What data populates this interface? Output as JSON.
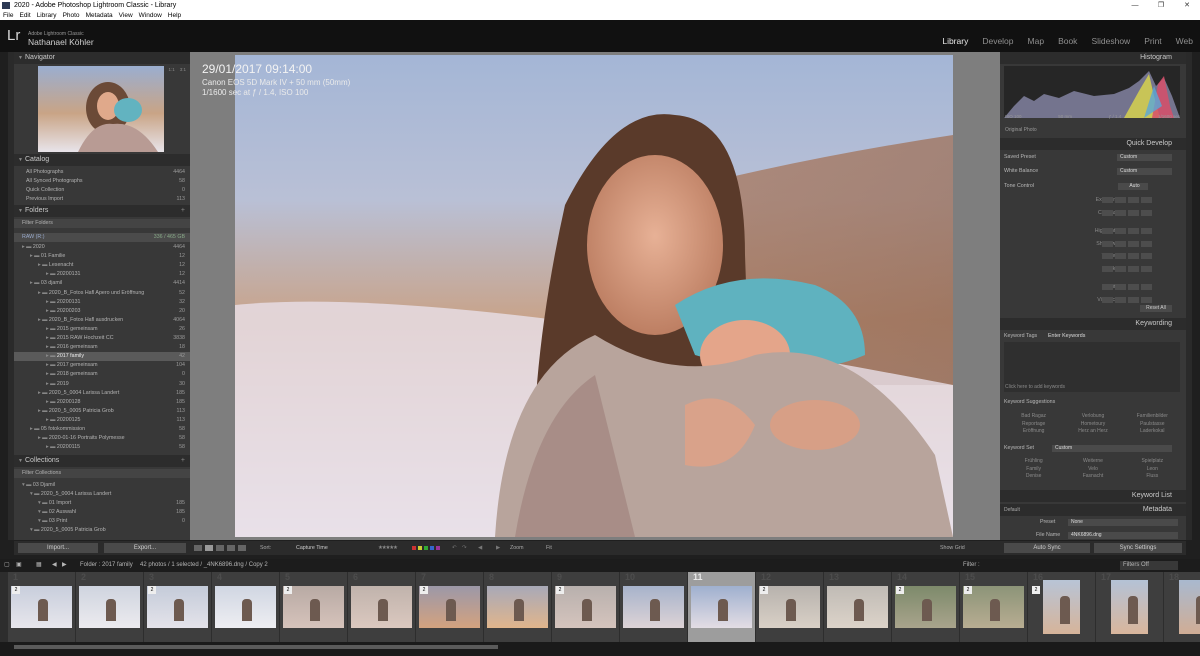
{
  "window": {
    "title": "2020 - Adobe Photoshop Lightroom Classic - Library",
    "menu": [
      "File",
      "Edit",
      "Library",
      "Photo",
      "Metadata",
      "View",
      "Window",
      "Help"
    ]
  },
  "identity": {
    "logo": "Lr",
    "product": "Adobe Lightroom Classic",
    "user": "Nathanael Köhler"
  },
  "modules": [
    "Library",
    "Develop",
    "Map",
    "Book",
    "Slideshow",
    "Print",
    "Web"
  ],
  "left": {
    "navigator": {
      "title": "Navigator",
      "zoom": [
        "FIT",
        "FILL",
        "1:1",
        "3:1"
      ]
    },
    "catalog": {
      "title": "Catalog",
      "items": [
        {
          "label": "All Photographs",
          "count": "4464"
        },
        {
          "label": "All Synced Photographs",
          "count": "58"
        },
        {
          "label": "Quick Collection",
          "count": "0"
        },
        {
          "label": "Previous Import",
          "count": "113"
        }
      ]
    },
    "folders": {
      "title": "Folders",
      "filter": "Filter Folders",
      "volume": "RAW (R:)",
      "volume_info": "336 / 465 GB",
      "items": [
        {
          "label": "2020",
          "count": "4464",
          "depth": 0
        },
        {
          "label": "01 Familie",
          "count": "12",
          "depth": 1
        },
        {
          "label": "Lesenacht",
          "count": "12",
          "depth": 2
        },
        {
          "label": "20200131",
          "count": "12",
          "depth": 3
        },
        {
          "label": "03 djamil",
          "count": "4414",
          "depth": 1
        },
        {
          "label": "2020_B_Fotos Hafl Apero und Eröffnung",
          "count": "52",
          "depth": 2
        },
        {
          "label": "20200131",
          "count": "32",
          "depth": 3
        },
        {
          "label": "20200203",
          "count": "20",
          "depth": 3
        },
        {
          "label": "2020_B_Fotos Hafl ausdrucken",
          "count": "4064",
          "depth": 2
        },
        {
          "label": "2015 gemeinsam",
          "count": "26",
          "depth": 3
        },
        {
          "label": "2015 RAW Hochzeit CC",
          "count": "3838",
          "depth": 3
        },
        {
          "label": "2016 gemeinsam",
          "count": "18",
          "depth": 3
        },
        {
          "label": "2017 family",
          "count": "42",
          "depth": 3,
          "selected": true
        },
        {
          "label": "2017 gemeinsam",
          "count": "104",
          "depth": 3
        },
        {
          "label": "2018 gemeinsam",
          "count": "0",
          "depth": 3
        },
        {
          "label": "2019",
          "count": "30",
          "depth": 3
        },
        {
          "label": "2020_5_0004 Larissa Landert",
          "count": "185",
          "depth": 2
        },
        {
          "label": "20200128",
          "count": "185",
          "depth": 3
        },
        {
          "label": "2020_5_0005 Patricia Grob",
          "count": "113",
          "depth": 2
        },
        {
          "label": "20200125",
          "count": "113",
          "depth": 3
        },
        {
          "label": "05 fotokommission",
          "count": "58",
          "depth": 1
        },
        {
          "label": "2020-01-16 Portraits Polymesse",
          "count": "58",
          "depth": 2
        },
        {
          "label": "20200115",
          "count": "58",
          "depth": 3
        }
      ]
    },
    "collections": {
      "title": "Collections",
      "filter": "Filter Collections",
      "items": [
        {
          "label": "03 Djamil",
          "count": "",
          "depth": 0
        },
        {
          "label": "2020_5_0004 Larissa Landert",
          "count": "",
          "depth": 1
        },
        {
          "label": "01 Import",
          "count": "185",
          "depth": 2
        },
        {
          "label": "02 Auswahl",
          "count": "185",
          "depth": 2
        },
        {
          "label": "03 Print",
          "count": "0",
          "depth": 2
        },
        {
          "label": "2020_5_0005 Patricia Grob",
          "count": "",
          "depth": 1
        }
      ]
    },
    "import_label": "Import...",
    "export_label": "Export..."
  },
  "photo": {
    "date": "29/01/2017 09:14:00",
    "camera": "Canon EOS 5D Mark IV + 50 mm (50mm)",
    "exposure": "1/1600 sec at ƒ / 1.4, ISO 100"
  },
  "toolbar": {
    "sort_label": "Sort:",
    "sort_value": "Capture Time",
    "rating": "★★★★★",
    "zoom_label": "Zoom",
    "zoom_value": "Fit",
    "show_grid": "Show Grid"
  },
  "right": {
    "histogram": {
      "title": "Histogram",
      "iso": "ISO 100",
      "focal": "50 mm",
      "aperture": "ƒ / 1.4",
      "shutter": "1/1600 sec",
      "original": "Original Photo"
    },
    "quick_develop": {
      "title": "Quick Develop",
      "saved_preset": "Saved Preset",
      "saved_preset_value": "Custom",
      "white_balance": "White Balance",
      "white_balance_value": "Custom",
      "tone_control": "Tone Control",
      "auto": "Auto",
      "sliders": [
        "Exposure",
        "Contrast",
        "Highlights",
        "Shadows",
        "Whites",
        "Blacks",
        "Clarity",
        "Vibrance"
      ],
      "reset": "Reset All"
    },
    "keywording": {
      "title": "Keywording",
      "tags_label": "Keyword Tags",
      "tags_placeholder": "Enter Keywords",
      "hint": "Click here to add keywords",
      "suggestions_title": "Keyword Suggestions",
      "suggestions": [
        "Bad Ragaz",
        "Verlobung",
        "Familienbilder",
        "Reportage",
        "Hometoury",
        "Paulstasse",
        "Eröffnung",
        "Herz an Herz",
        "Laderkokal"
      ],
      "set_label": "Keyword Set",
      "set_value": "Custom",
      "set": [
        "Frühling",
        "Weiterne",
        "Spielplatz",
        "Family",
        "Velo",
        "Leon",
        "Denise",
        "Fasnacht",
        "Fluss"
      ]
    },
    "keyword_list": "Keyword List",
    "metadata": {
      "title": "Metadata",
      "preset_default": "Default",
      "preset_label": "Preset",
      "preset_value": "None",
      "filename_label": "File Name",
      "filename_value": "4NK6896.dng"
    },
    "sync_label": "Auto Sync",
    "sync_settings": "Sync Settings"
  },
  "filmstrip": {
    "info": "Folder : 2017 family",
    "count": "42 photos / 1 selected / _4NK6896.dng / Copy 2",
    "filter_label": "Filter :",
    "filters_off": "Filters Off",
    "cells": [
      {
        "num": "1",
        "badge": "2"
      },
      {
        "num": "2",
        "badge": ""
      },
      {
        "num": "3",
        "badge": "2"
      },
      {
        "num": "4",
        "badge": ""
      },
      {
        "num": "5",
        "badge": "2"
      },
      {
        "num": "6",
        "badge": ""
      },
      {
        "num": "7",
        "badge": "2"
      },
      {
        "num": "8",
        "badge": ""
      },
      {
        "num": "9",
        "badge": "2"
      },
      {
        "num": "10",
        "badge": ""
      },
      {
        "num": "11",
        "badge": "",
        "selected": true
      },
      {
        "num": "12",
        "badge": "2"
      },
      {
        "num": "13",
        "badge": ""
      },
      {
        "num": "14",
        "badge": "2"
      },
      {
        "num": "15",
        "badge": "2"
      },
      {
        "num": "16",
        "badge": "2"
      },
      {
        "num": "17",
        "badge": ""
      },
      {
        "num": "18",
        "badge": ""
      }
    ]
  }
}
